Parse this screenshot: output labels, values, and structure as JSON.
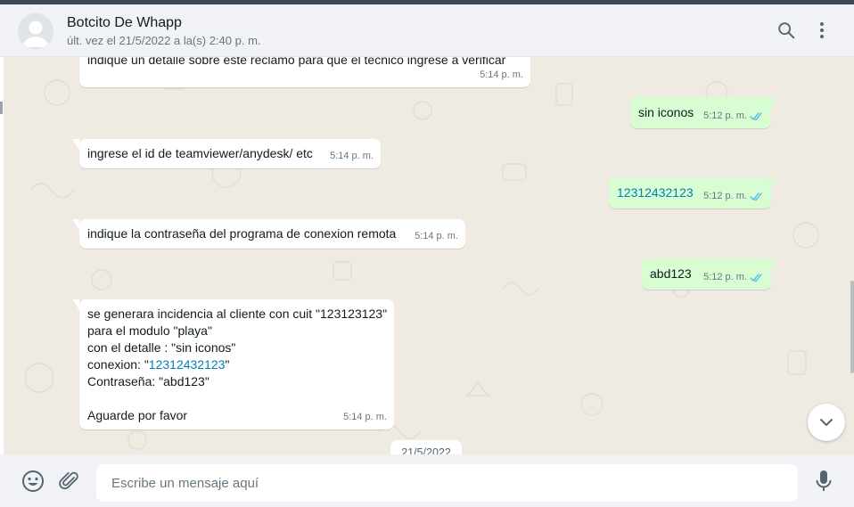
{
  "header": {
    "contact_name": "Botcito De Whapp",
    "last_seen": "últ. vez el 21/5/2022 a la(s) 2:40 p. m.",
    "search_icon": "search-icon",
    "menu_icon": "kebab-menu-icon"
  },
  "messages": [
    {
      "direction": "in",
      "text": "indique un detalle sobre este reclamo para que el técnico ingrese a verificar",
      "time": "5:14 p. m."
    },
    {
      "direction": "out",
      "text": "sin iconos",
      "time": "5:12 p. m.",
      "status": "read"
    },
    {
      "direction": "in",
      "text": "ingrese el id de teamviewer/anydesk/ etc",
      "time": "5:14 p. m."
    },
    {
      "direction": "out",
      "text": "12312432123",
      "time": "5:12 p. m.",
      "status": "read",
      "is_link": true
    },
    {
      "direction": "in",
      "text": "indique la contraseña del programa de conexion remota",
      "time": "5:14 p. m."
    },
    {
      "direction": "out",
      "text": "abd123",
      "time": "5:12 p. m.",
      "status": "read"
    },
    {
      "direction": "in",
      "lines": {
        "l1": "se generara incidencia al cliente con cuit \"123123123\"",
        "l2": "para el modulo \"playa\"",
        "l3": "con el detalle : \"sin iconos\"",
        "l4_prefix": "conexion: \"",
        "l4_link": "12312432123",
        "l4_suffix": "\"",
        "l5": "Contraseña: \"abd123\"",
        "l6": "Aguarde por favor"
      },
      "time": "5:14 p. m."
    }
  ],
  "date_chip": "21/5/2022",
  "footer": {
    "emoji_icon": "emoji-icon",
    "attach_icon": "paperclip-icon",
    "placeholder": "Escribe un mensaje aquí",
    "mic_icon": "microphone-icon"
  },
  "colors": {
    "incoming_bubble": "#ffffff",
    "outgoing_bubble": "#d9fdd3",
    "chat_background": "#efeae2",
    "read_ticks": "#53bdeb",
    "link": "#027eb5"
  }
}
